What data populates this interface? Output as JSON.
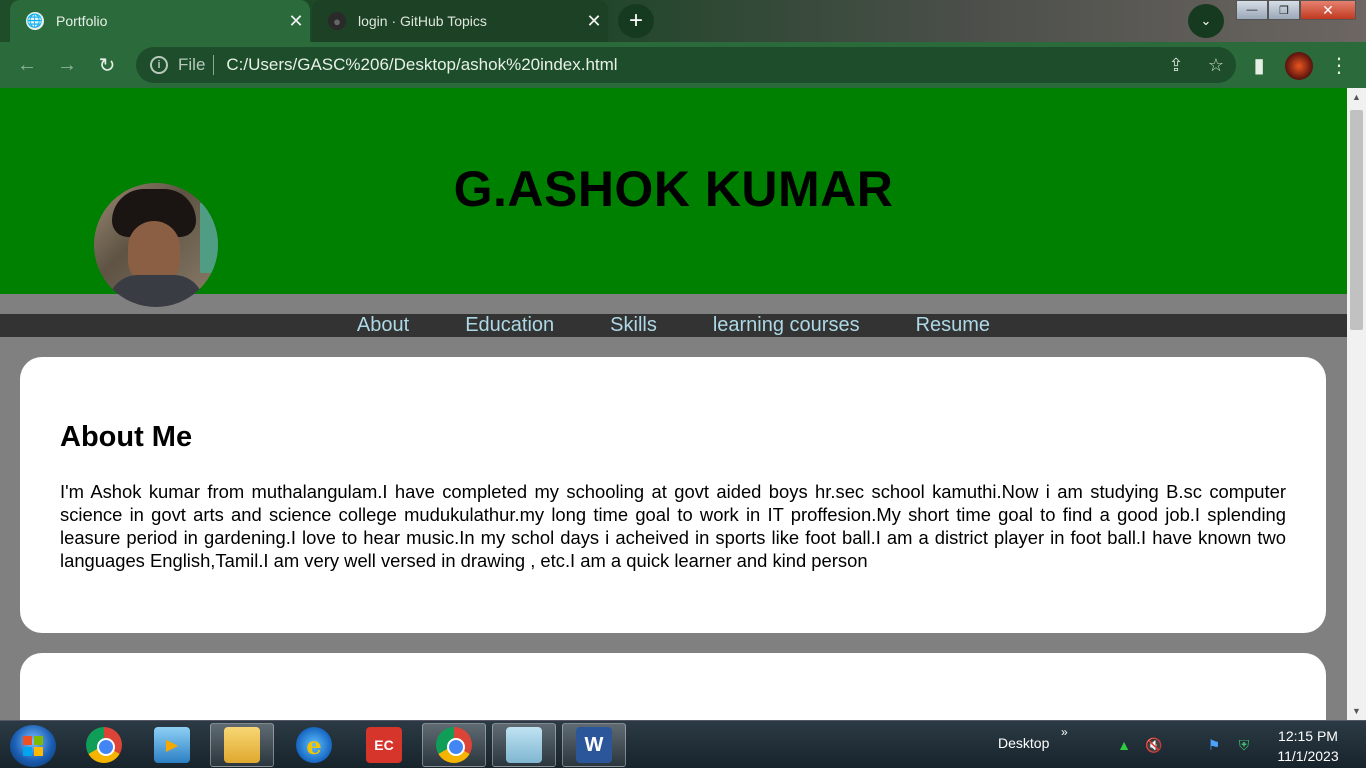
{
  "browser": {
    "tabs": [
      {
        "title": "Portfolio",
        "active": true
      },
      {
        "title": "login · GitHub Topics",
        "active": false
      }
    ],
    "address": {
      "scheme": "File",
      "url": "C:/Users/GASC%206/Desktop/ashok%20index.html"
    },
    "icons": {
      "back": "←",
      "forward": "→",
      "reload": "↻",
      "info": "i",
      "share": "⇪",
      "star": "☆",
      "sidepanel": "▮",
      "menu": "⋮",
      "newtab": "+",
      "tabsearch": "⌄",
      "close": "✕"
    },
    "window_controls": {
      "minimize": "—",
      "maximize": "❐",
      "close": "✕"
    }
  },
  "page": {
    "header_title": "G.ASHOK KUMAR",
    "nav": [
      "About",
      "Education",
      "Skills",
      "learning courses",
      "Resume"
    ],
    "about": {
      "heading": "About Me",
      "text": "I'm Ashok kumar from muthalangulam.I have completed my schooling at govt aided boys hr.sec school kamuthi.Now i am studying B.sc computer science in govt arts and science college mudukulathur.my long time goal to work in IT proffesion.My short time goal to find a good job.I splending leasure period in gardening.I love to hear music.In my schol days i acheived in sports like foot ball.I am a district player in foot ball.I have known two languages English,Tamil.I am very well versed in drawing , etc.I am a quick learner and kind person"
    },
    "colors": {
      "header_bg": "#008000",
      "nav_bg": "#333333",
      "nav_link": "#add8e6",
      "page_bg": "#808080"
    }
  },
  "taskbar": {
    "items": [
      "start-button",
      "chrome-icon",
      "media-player-icon",
      "file-explorer-icon",
      "internet-explorer-icon",
      "ec-app-icon",
      "chrome-profile-icon",
      "notepad-icon",
      "word-icon"
    ],
    "word_glyph": "W",
    "ie_glyph": "e",
    "ec_glyph": "EC",
    "desktop_label": "Desktop",
    "chevron": "»",
    "tray_glyphs": {
      "green": "▲",
      "volume": "🔇",
      "flag": "⚑",
      "shield": "⛨"
    },
    "clock_time": "12:15 PM",
    "clock_date": "11/1/2023"
  }
}
